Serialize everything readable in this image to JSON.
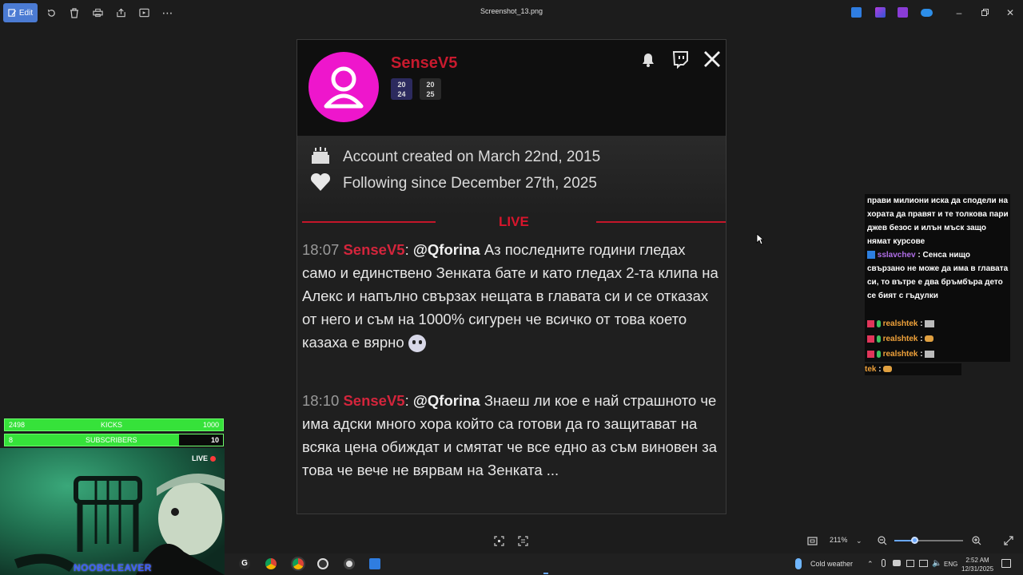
{
  "titlebar": {
    "edit_label": "Edit",
    "file_title": "Screenshot_13.png"
  },
  "profile": {
    "username": "SenseV5",
    "badges": [
      {
        "line1": "20",
        "line2": "24"
      },
      {
        "line1": "20",
        "line2": "25"
      }
    ],
    "account_created": "Account created on March 22nd, 2015",
    "following_since": "Following since December 27th, 2025",
    "live_label": "LIVE"
  },
  "messages": [
    {
      "time": "18:07",
      "nick": "SenseV5",
      "mention": "@Qforina",
      "text": "Аз последните години гледах само и единствено Зенката бате и като гледах 2-та клипа на Алекс и напълно свързах нещата в главата си и се отказах от него и съм на 1000% сигурен че всичко от това което казаха е вярно"
    },
    {
      "time": "18:10",
      "nick": "SenseV5",
      "mention": "@Qforina",
      "text": "Знаеш ли кое е най страшното че има адски много хора който са готови да го защитават на всяка цена обиждат и смятат че все едно аз съм виновен за това че вече не вярвам на Зенката ..."
    }
  ],
  "side_chat": {
    "first_text": "прави милиони иска да сподели на хората да правят и те толкова пари джев безос и илън мъск защо нямат курсове",
    "second_user": "sslavchev",
    "second_text": "Сенса нищо свързано не може да има в главата си, то вътре е два бръмбъра дето се бият с гъдулки",
    "realshtek_lines": [
      "realshtek",
      "realshtek",
      "realshtek"
    ],
    "partial_user": "tek"
  },
  "stream": {
    "kicks_label": "KICKS",
    "kicks_current": "2498",
    "kicks_goal": "1000",
    "kicks_progress": 1.0,
    "subs_label": "SUBSCRIBERS",
    "subs_current": "8",
    "subs_goal": "10",
    "subs_progress": 0.8,
    "live_tag": "LIVE",
    "streamer_name": "NOOBCLEAVER"
  },
  "viewer_controls": {
    "zoom_value": "211%"
  },
  "taskbar": {
    "weather": "Cold weather",
    "lang": "ENG",
    "time": "2:52 AM",
    "date": "12/31/2025"
  },
  "colors": {
    "avatar_bg": "#ee16cc",
    "nick_red": "#d4253c",
    "bar_green": "#36e23a",
    "edit_blue": "#4b7bd3"
  }
}
